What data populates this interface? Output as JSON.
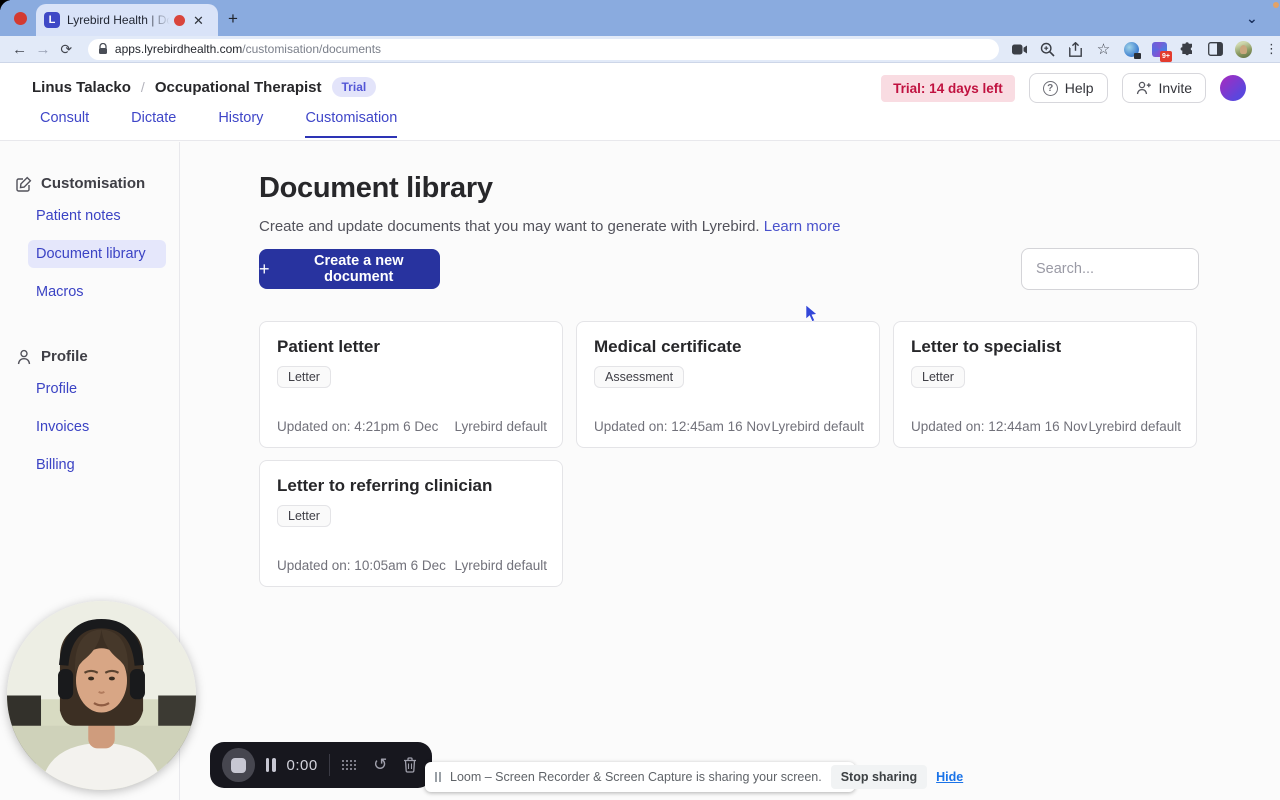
{
  "browser": {
    "tab_title": "Lyrebird Health | Documen",
    "favicon_letter": "L",
    "url_host": "apps.lyrebirdhealth.com",
    "url_path": "/customisation/documents",
    "extension_badge": "9+"
  },
  "glyphs": {
    "back": "←",
    "forward": "→",
    "reload": "⟳",
    "close": "✕",
    "plus": "+",
    "star": "☆",
    "kebab": "⋮",
    "chevron_down": "⌄",
    "question": "?",
    "restart": "↺"
  },
  "header": {
    "user_name": "Linus Talacko",
    "separator": "/",
    "role": "Occupational Therapist",
    "trial_badge": "Trial",
    "trial_banner": "Trial: 14 days left",
    "help_label": "Help",
    "invite_label": "Invite"
  },
  "nav": {
    "items": [
      {
        "label": "Consult"
      },
      {
        "label": "Dictate"
      },
      {
        "label": "History"
      },
      {
        "label": "Customisation"
      }
    ],
    "active": "Customisation"
  },
  "sidebar": {
    "sections": [
      {
        "title": "Customisation",
        "items": [
          {
            "label": "Patient notes"
          },
          {
            "label": "Document library",
            "selected": true
          },
          {
            "label": "Macros"
          }
        ]
      },
      {
        "title": "Profile",
        "items": [
          {
            "label": "Profile"
          },
          {
            "label": "Invoices"
          },
          {
            "label": "Billing"
          }
        ]
      }
    ]
  },
  "main": {
    "title": "Document library",
    "description": "Create and update documents that you may want to generate with Lyrebird.",
    "learn_more": "Learn more",
    "create_button": "Create a new document",
    "search_placeholder": "Search...",
    "cards": [
      {
        "title": "Patient letter",
        "badge": "Letter",
        "updated": "Updated on: 4:21pm 6 Dec",
        "source": "Lyrebird default"
      },
      {
        "title": "Medical certificate",
        "badge": "Assessment",
        "updated": "Updated on: 12:45am 16 Nov",
        "source": "Lyrebird default"
      },
      {
        "title": "Letter to specialist",
        "badge": "Letter",
        "updated": "Updated on: 12:44am 16 Nov",
        "source": "Lyrebird default"
      },
      {
        "title": "Letter to referring clinician",
        "badge": "Letter",
        "updated": "Updated on: 10:05am 6 Dec",
        "source": "Lyrebird default"
      }
    ]
  },
  "loom": {
    "time": "0:00",
    "sharing_text": "Loom – Screen Recorder & Screen Capture is sharing your screen.",
    "stop_sharing_label": "Stop sharing",
    "hide_label": "Hide"
  },
  "colors": {
    "brand_indigo": "#3f46c8",
    "button_indigo": "#28339f",
    "trial_red_text": "#c01240",
    "trial_red_bg": "#f9dce2",
    "tabstrip_blue": "#8aabdf"
  }
}
